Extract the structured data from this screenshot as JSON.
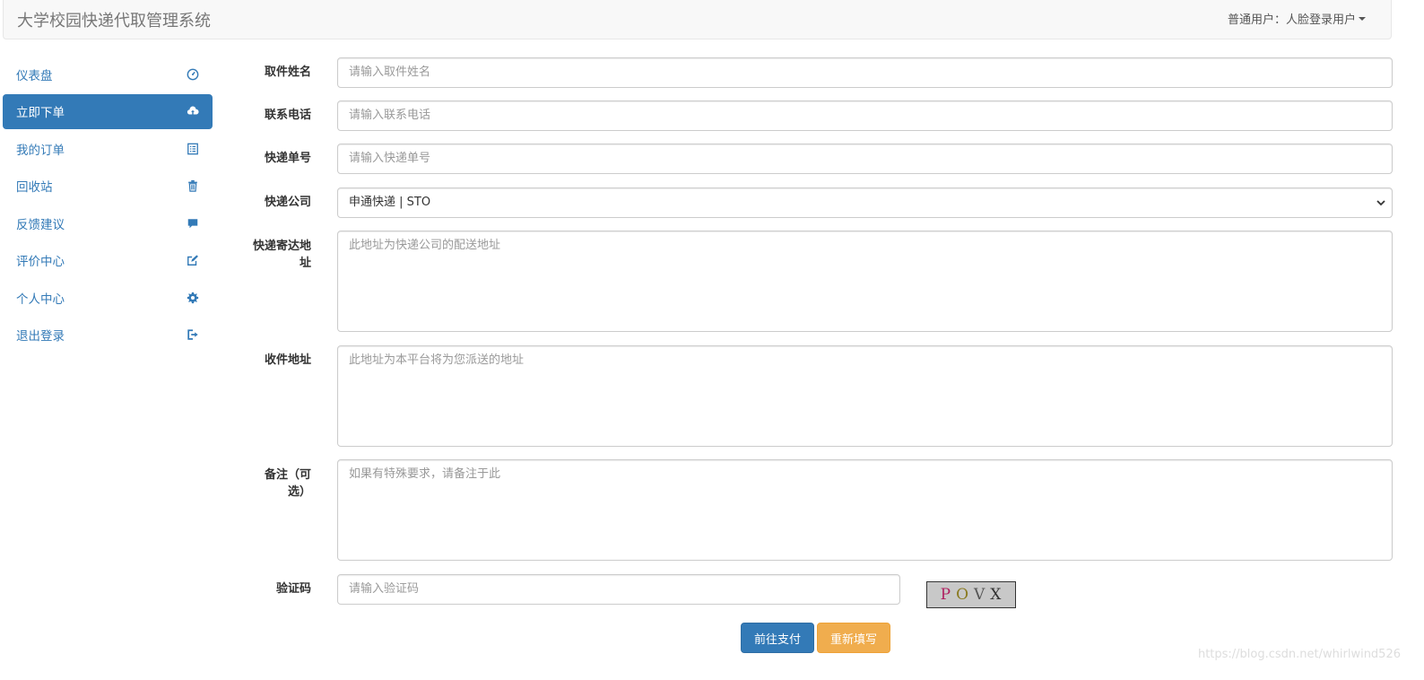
{
  "header": {
    "title": "大学校园快递代取管理系统",
    "user_menu": "普通用户：人脸登录用户"
  },
  "sidebar": {
    "items": [
      {
        "label": "仪表盘",
        "icon": "dashboard-icon"
      },
      {
        "label": "立即下单",
        "icon": "cloud-upload-icon",
        "active": true
      },
      {
        "label": "我的订单",
        "icon": "list-alt-icon"
      },
      {
        "label": "回收站",
        "icon": "trash-icon"
      },
      {
        "label": "反馈建议",
        "icon": "comment-icon"
      },
      {
        "label": "评价中心",
        "icon": "edit-icon"
      },
      {
        "label": "个人中心",
        "icon": "cog-icon"
      },
      {
        "label": "退出登录",
        "icon": "log-out-icon"
      }
    ]
  },
  "form": {
    "name_label": "取件姓名",
    "name_placeholder": "请输入取件姓名",
    "phone_label": "联系电话",
    "phone_placeholder": "请输入联系电话",
    "tracking_label": "快递单号",
    "tracking_placeholder": "请输入快递单号",
    "company_label": "快递公司",
    "company_value": "申通快递 | STO",
    "send_address_label_1": "快递寄达地",
    "send_address_label_2": "址",
    "send_address_placeholder": "此地址为快递公司的配送地址",
    "receive_address_label": "收件地址",
    "receive_address_placeholder": "此地址为本平台将为您派送的地址",
    "note_label_1": "备注（可",
    "note_label_2": "选）",
    "note_placeholder": "如果有特殊要求，请备注于此",
    "captcha_label": "验证码",
    "captcha_placeholder": "请输入验证码",
    "captcha_chars": [
      "P",
      "O",
      "V",
      "X"
    ],
    "pay_button": "前往支付",
    "reset_button": "重新填写"
  },
  "watermark": "https://blog.csdn.net/whirlwind526",
  "colors": {
    "primary": "#337ab7",
    "warning": "#f0ad4e",
    "navbar_bg": "#f8f8f8"
  }
}
